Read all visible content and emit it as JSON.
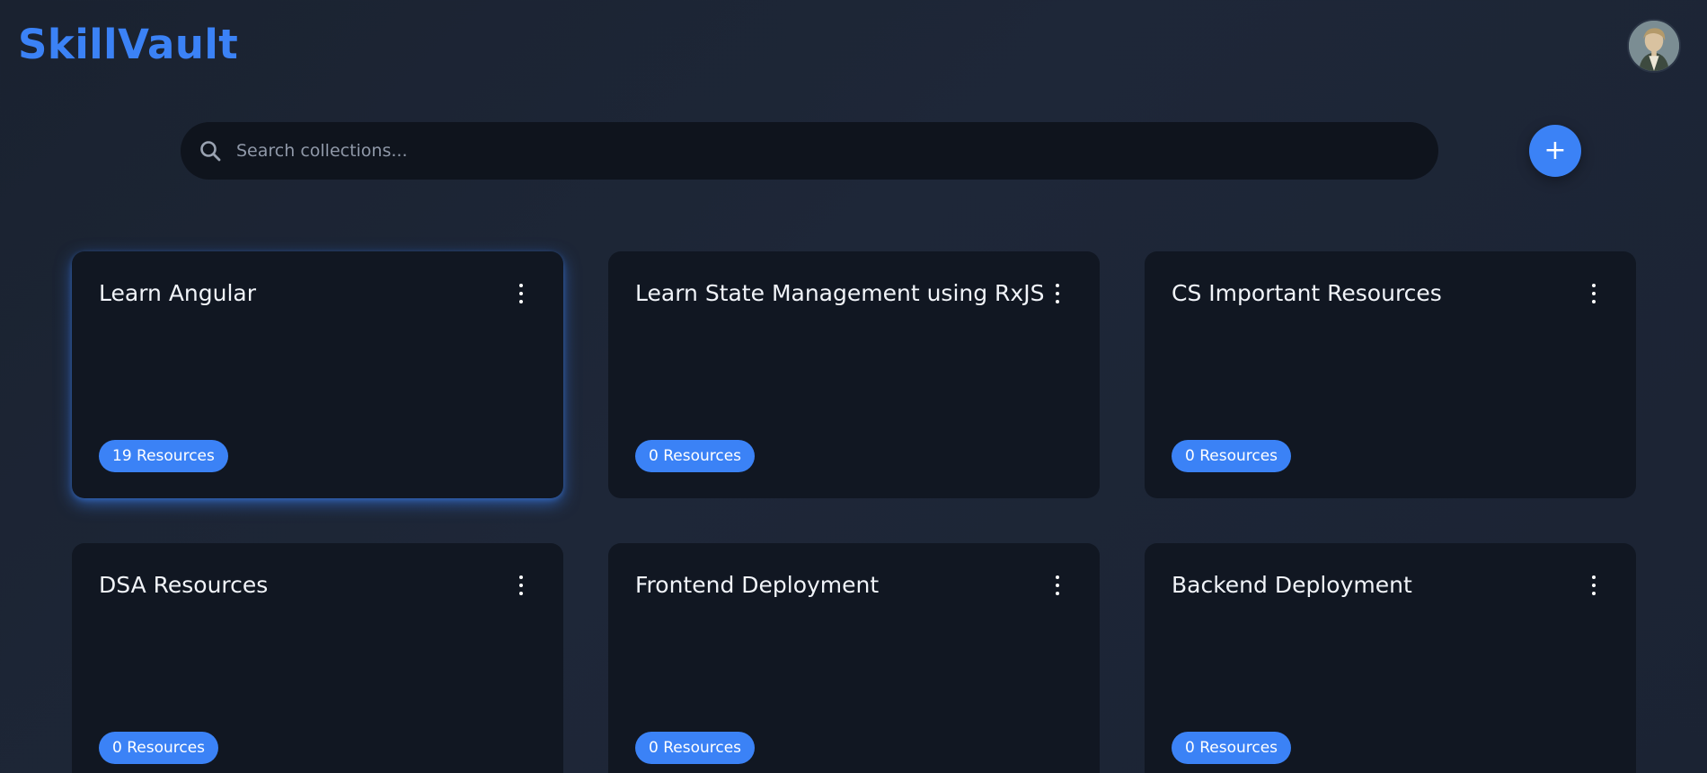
{
  "header": {
    "brand": "SkillVault",
    "avatar_icon": "user-avatar-icon"
  },
  "search": {
    "placeholder": "Search collections...",
    "value": "",
    "icon": "search-icon"
  },
  "actions": {
    "add_label": "+",
    "add_icon": "plus-icon"
  },
  "colors": {
    "accent": "#3b82f6",
    "background": "#1c2433",
    "card": "#111722"
  },
  "collections": [
    {
      "title": "Learn Angular",
      "resources": "19 Resources",
      "highlighted": true
    },
    {
      "title": "Learn State Management using RxJS",
      "resources": "0 Resources",
      "highlighted": false
    },
    {
      "title": "CS Important Resources",
      "resources": "0 Resources",
      "highlighted": false
    },
    {
      "title": "DSA Resources",
      "resources": "0 Resources",
      "highlighted": false
    },
    {
      "title": "Frontend Deployment",
      "resources": "0 Resources",
      "highlighted": false
    },
    {
      "title": "Backend Deployment",
      "resources": "0 Resources",
      "highlighted": false
    }
  ]
}
